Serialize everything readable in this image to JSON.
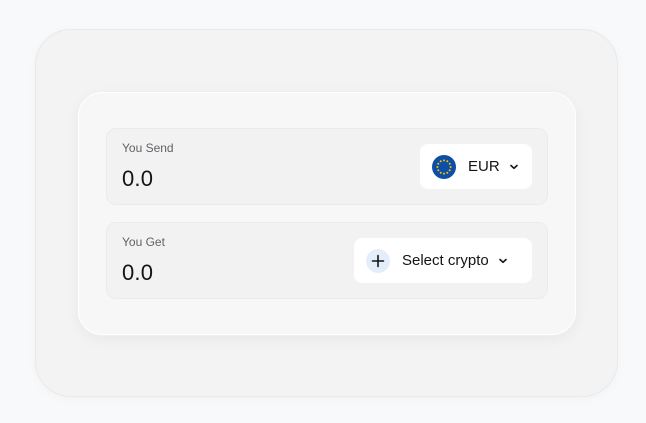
{
  "send": {
    "label": "You Send",
    "amount": "0.0",
    "currency": {
      "code": "EUR",
      "icon": "eu-flag-icon"
    }
  },
  "get": {
    "label": "You Get",
    "amount": "0.0",
    "crypto": {
      "label": "Select crypto",
      "icon": "plus-icon"
    }
  },
  "colors": {
    "background": "#f7f9fb",
    "panel": "#f3f3f3",
    "card": "#f7f7f7",
    "row": "#f2f2f2",
    "selector": "#ffffff",
    "eu_blue": "#0d4ea6",
    "eu_gold": "#f5c400",
    "plus_badge": "#e4eefa"
  }
}
